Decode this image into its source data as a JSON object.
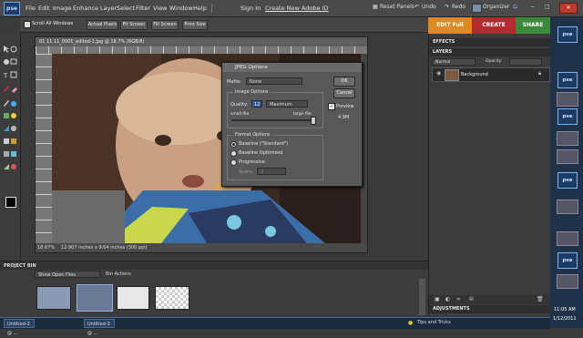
{
  "app": {
    "logo": "pse"
  },
  "menu": [
    "File",
    "Edit",
    "Image",
    "Enhance",
    "Layer",
    "Select",
    "Filter",
    "View",
    "Window",
    "Help"
  ],
  "menu_right": {
    "signin": "Sign In",
    "create_id": "Create New Adobe ID"
  },
  "top_buttons": {
    "reset_panels": "Reset Panels",
    "undo": "Undo",
    "redo": "Redo",
    "organizer": "Organizer"
  },
  "options_bar": {
    "scroll_all_windows": "Scroll All Windows",
    "actual_pixels": "Actual Pixels",
    "fit_screen": "Fit Screen",
    "fill_screen": "Fill Screen",
    "print_size": "Print Size"
  },
  "mode_tabs": {
    "edit_full": "EDIT Full",
    "create": "CREATE",
    "share": "SHARE"
  },
  "document": {
    "title": "01 11 11_0001_edited-1.jpg @ 18.7% (RGB/8)",
    "zoom": "18.67%",
    "status": "12.907 inches x 9.64 inches (300 ppi)"
  },
  "jpeg_dialog": {
    "title": "JPEG Options",
    "matte_label": "Matte:",
    "matte_value": "None",
    "ok": "OK",
    "cancel": "Cancel",
    "image_options_label": "Image Options",
    "quality_label": "Quality:",
    "quality_value": "12",
    "quality_preset": "Maximum",
    "small_file": "small file",
    "large_file": "large file",
    "preview_label": "Preview",
    "file_size": "4.9M",
    "format_options_label": "Format Options",
    "formats": [
      "Baseline (\"Standard\")",
      "Baseline Optimized",
      "Progressive"
    ],
    "selected_format": 0,
    "scans_label": "Scans:",
    "scans_value": "3"
  },
  "panels": {
    "effects": "EFFECTS",
    "layers": "LAYERS",
    "blend_mode": "Normal",
    "opacity_label": "Opacity:",
    "background_layer": "Background",
    "adjustments": "ADJUSTMENTS"
  },
  "project_bin": {
    "header": "PROJECT BIN",
    "show_select": "Show Open Files",
    "bin_actions": "Bin Actions"
  },
  "taskbar": {
    "tab1": "Untitled-2 @ ...",
    "tab2": "Untitled-3 @ ...",
    "tips": "Tips and Tricks",
    "time": "11:05 AM",
    "date": "1/12/2011"
  },
  "icons": [
    "arrow-icon",
    "hand-icon",
    "zoom-icon",
    "lasso-icon",
    "text-icon",
    "crop-icon",
    "brush-icon",
    "eraser-icon",
    "eyedropper-icon",
    "heal-icon",
    "shape-icon",
    "blur-icon"
  ]
}
